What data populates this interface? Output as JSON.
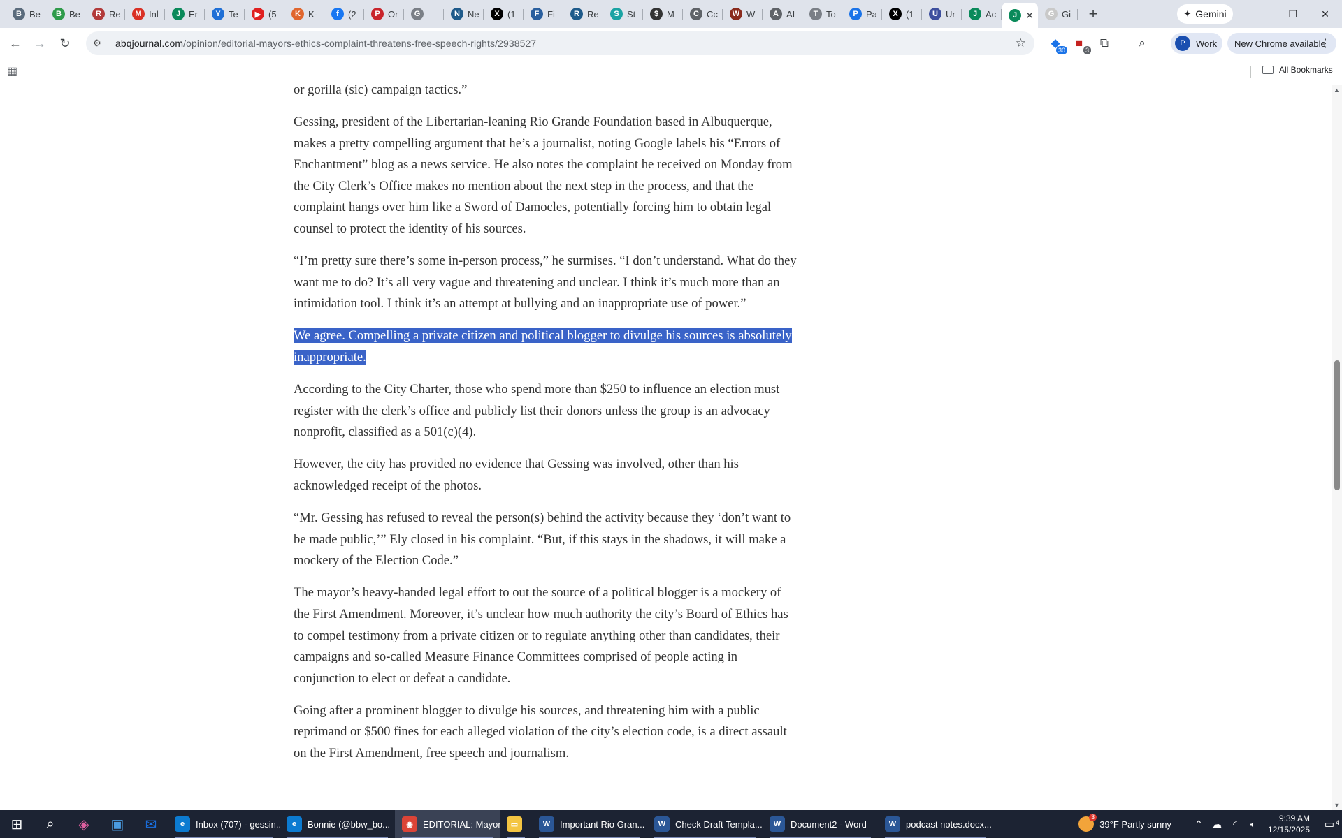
{
  "browser": {
    "tabs": [
      {
        "label": "Be",
        "color": "#5a6b7c",
        "glyph": "B"
      },
      {
        "label": "Be",
        "color": "#2e9b4a",
        "glyph": "B"
      },
      {
        "label": "Re",
        "color": "#b23a3a",
        "glyph": "R"
      },
      {
        "label": "Inl",
        "color": "#d93025",
        "glyph": "M"
      },
      {
        "label": "Er",
        "color": "#0a8a5a",
        "glyph": "J"
      },
      {
        "label": "Te",
        "color": "#1f6fd6",
        "glyph": "Y"
      },
      {
        "label": "(5",
        "color": "#e02020",
        "glyph": "▶"
      },
      {
        "label": "K-",
        "color": "#e0662e",
        "glyph": "K"
      },
      {
        "label": "(2",
        "color": "#1877f2",
        "glyph": "f"
      },
      {
        "label": "Or",
        "color": "#c9252c",
        "glyph": "P"
      },
      {
        "label": "",
        "color": "#7a7f86",
        "glyph": "G"
      },
      {
        "label": "Ne",
        "color": "#1e5a8a",
        "glyph": "N"
      },
      {
        "label": "(1",
        "color": "#000000",
        "glyph": "X"
      },
      {
        "label": "Fi",
        "color": "#2a5f9e",
        "glyph": "F"
      },
      {
        "label": "Re",
        "color": "#1e5a8a",
        "glyph": "R"
      },
      {
        "label": "St",
        "color": "#1aa3a3",
        "glyph": "S"
      },
      {
        "label": "M",
        "color": "#333333",
        "glyph": "$"
      },
      {
        "label": "Cc",
        "color": "#5f6368",
        "glyph": "C"
      },
      {
        "label": "W",
        "color": "#8a2b1c",
        "glyph": "W"
      },
      {
        "label": "AI",
        "color": "#5f6368",
        "glyph": "A"
      },
      {
        "label": "To",
        "color": "#7a7f86",
        "glyph": "T"
      },
      {
        "label": "Pa",
        "color": "#1a73e8",
        "glyph": "P"
      },
      {
        "label": "(1",
        "color": "#000000",
        "glyph": "X"
      },
      {
        "label": "Ur",
        "color": "#3d4f9e",
        "glyph": "U"
      },
      {
        "label": "Ac",
        "color": "#0a8a5a",
        "glyph": "J"
      },
      {
        "label": "",
        "color": "#0a8a5a",
        "glyph": "J",
        "active": true
      },
      {
        "label": "Gi",
        "color": "#c9c9c9",
        "glyph": "G"
      }
    ],
    "new_tab": "+",
    "gemini_label": "Gemini",
    "window": {
      "minimize": "—",
      "restore": "❐",
      "close": "✕"
    },
    "toolbar": {
      "back": "←",
      "forward": "→",
      "reload": "↻",
      "url_host": "abqjournal.com",
      "url_path": "/opinion/editorial-mayors-ethics-complaint-threatens-free-speech-rights/2938527",
      "ext_badge_1": "30",
      "ext_badge_2": "3",
      "profile_initial": "P",
      "profile_label": "Work",
      "update_label": "New Chrome available"
    },
    "bookmarks": {
      "all_label": "All Bookmarks"
    }
  },
  "article": {
    "paragraphs": [
      "or gorilla (sic) campaign tactics.”",
      "Gessing, president of the Libertarian-leaning Rio Grande Foundation based in Albuquerque, makes a pretty compelling argument that he’s a journalist, noting Google labels his “Errors of Enchantment” blog as a news service. He also notes the complaint he received on Monday from the City Clerk’s Office makes no mention about the next step in the process, and that the complaint hangs over him like a Sword of Damocles, potentially forcing him to obtain legal counsel to protect the identity of his sources.",
      "“I’m pretty sure there’s some in-person process,” he surmises. “I don’t understand. What do they want me to do? It’s all very vague and threatening and unclear. I think it’s much more than an intimidation tool. I think it’s an attempt at bullying and an inappropriate use of power.”",
      "We agree. Compelling a private citizen and political blogger to divulge his sources is absolutely inappropriate.",
      "According to the City Charter, those who spend more than $250 to influence an election must register with the clerk’s office and publicly list their donors unless the group is an advocacy nonprofit, classified as a 501(c)(4).",
      "However, the city has provided no evidence that Gessing was involved, other than his acknowledged receipt of the photos.",
      "“Mr. Gessing has refused to reveal the person(s) behind the activity because they ‘don’t want to be made public,’” Ely closed in his complaint. “But, if this stays in the shadows, it will make a mockery of the Election Code.”",
      "The mayor’s heavy-handed legal effort to out the source of a political blogger is a mockery of the First Amendment. Moreover, it’s unclear how much authority the city’s Board of Ethics has to compel testimony from a private citizen or to regulate anything other than candidates, their campaigns and so-called Measure Finance Committees comprised of people acting in conjunction to elect or defeat a candidate.",
      "Going after a prominent blogger to divulge his sources, and threatening him with a public reprimand or $500 fines for each alleged violation of the city’s election code, is a direct assault on the First Amendment, free speech and journalism."
    ]
  },
  "taskbar": {
    "apps": [
      {
        "label": "Inbox (707) - gessin...",
        "color": "#0c7bd1",
        "glyph": "e"
      },
      {
        "label": "Bonnie (@bbw_bo...",
        "color": "#0c7bd1",
        "glyph": "e"
      },
      {
        "label": "EDITORIAL: Mayor's...",
        "color": "#db4437",
        "glyph": "◉",
        "active": true
      },
      {
        "label": "",
        "color": "#f4c542",
        "glyph": "▭"
      },
      {
        "label": "Important Rio Gran...",
        "color": "#2b5797",
        "glyph": "W"
      },
      {
        "label": "Check Draft Templa...",
        "color": "#2b5797",
        "glyph": "W"
      },
      {
        "label": "Document2 - Word",
        "color": "#2b5797",
        "glyph": "W"
      },
      {
        "label": "podcast notes.docx...",
        "color": "#2b5797",
        "glyph": "W"
      }
    ],
    "weather_badge": "3",
    "weather": "39°F  Partly sunny",
    "time": "9:39 AM",
    "date": "12/15/2025",
    "notif_count": "4"
  }
}
